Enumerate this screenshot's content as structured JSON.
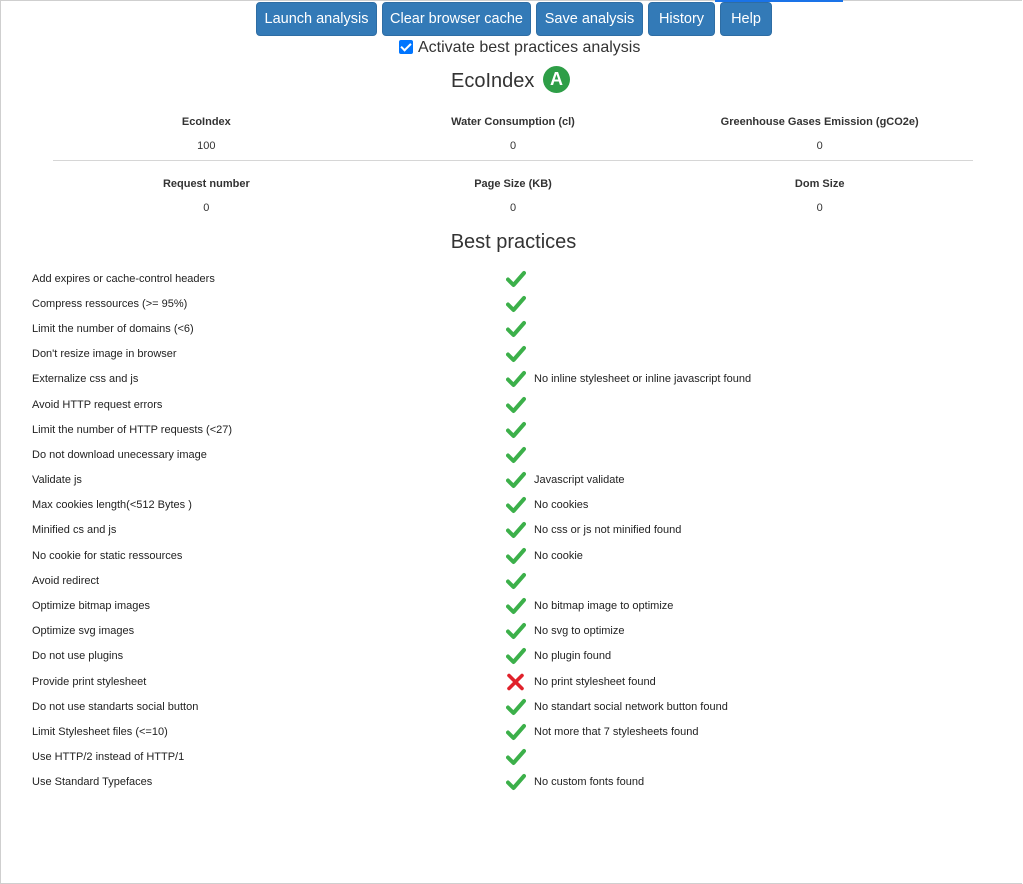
{
  "toolbar": {
    "launch": "Launch analysis",
    "clear_cache": "Clear browser cache",
    "save": "Save analysis",
    "history": "History",
    "help": "Help"
  },
  "activate_label": "Activate best practices analysis",
  "activate_checked": true,
  "ecoindex": {
    "title": "EcoIndex",
    "grade": "A",
    "grade_color": "#2e9e47"
  },
  "metrics": {
    "row1": [
      {
        "label": "EcoIndex",
        "value": "100"
      },
      {
        "label": "Water Consumption (cl)",
        "value": "0"
      },
      {
        "label": "Greenhouse Gases Emission (gCO2e)",
        "value": "0"
      }
    ],
    "row2": [
      {
        "label": "Request number",
        "value": "0"
      },
      {
        "label": "Page Size (KB)",
        "value": "0"
      },
      {
        "label": "Dom Size",
        "value": "0"
      }
    ]
  },
  "best_practices": {
    "title": "Best practices",
    "colors": {
      "pass": "#3cb04a",
      "fail": "#e0222b"
    },
    "items": [
      {
        "name": "Add expires or cache-control headers",
        "status": "pass",
        "comment": ""
      },
      {
        "name": "Compress ressources (>= 95%)",
        "status": "pass",
        "comment": ""
      },
      {
        "name": "Limit the number of domains (<6)",
        "status": "pass",
        "comment": ""
      },
      {
        "name": "Don't resize image in browser",
        "status": "pass",
        "comment": ""
      },
      {
        "name": "Externalize css and js",
        "status": "pass",
        "comment": "No inline stylesheet or inline javascript found"
      },
      {
        "name": "Avoid HTTP request errors",
        "status": "pass",
        "comment": ""
      },
      {
        "name": "Limit the number of HTTP requests (<27)",
        "status": "pass",
        "comment": ""
      },
      {
        "name": "Do not download unecessary image",
        "status": "pass",
        "comment": ""
      },
      {
        "name": "Validate js",
        "status": "pass",
        "comment": "Javascript validate"
      },
      {
        "name": "Max cookies length(<512 Bytes )",
        "status": "pass",
        "comment": "No cookies"
      },
      {
        "name": "Minified cs and js",
        "status": "pass",
        "comment": "No css or js not minified found"
      },
      {
        "name": "No cookie for static ressources",
        "status": "pass",
        "comment": "No cookie"
      },
      {
        "name": "Avoid redirect",
        "status": "pass",
        "comment": ""
      },
      {
        "name": "Optimize bitmap images",
        "status": "pass",
        "comment": "No bitmap image to optimize"
      },
      {
        "name": "Optimize svg images",
        "status": "pass",
        "comment": "No svg to optimize"
      },
      {
        "name": "Do not use plugins",
        "status": "pass",
        "comment": "No plugin found"
      },
      {
        "name": "Provide print stylesheet",
        "status": "fail",
        "comment": "No print stylesheet found"
      },
      {
        "name": "Do not use standarts social button",
        "status": "pass",
        "comment": "No standart social network button found"
      },
      {
        "name": "Limit Stylesheet files (<=10)",
        "status": "pass",
        "comment": "Not more that 7 stylesheets found"
      },
      {
        "name": "Use HTTP/2 instead of HTTP/1",
        "status": "pass",
        "comment": ""
      },
      {
        "name": "Use Standard Typefaces",
        "status": "pass",
        "comment": "No custom fonts found"
      }
    ]
  }
}
